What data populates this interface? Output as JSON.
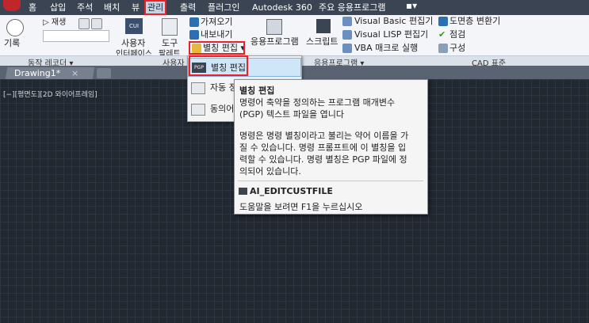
{
  "menubar": {
    "items": [
      "홈",
      "삽입",
      "주석",
      "배치",
      "뷰",
      "관리",
      "출력",
      "플러그인",
      "Autodesk 360",
      "주요 응용프로그램"
    ],
    "active": "관리"
  },
  "ribbon": {
    "action_recorder": {
      "record": "기록",
      "play": "재생"
    },
    "customization": {
      "user_interface": "사용자\n인터페이스",
      "tool_palette": "도구\n팔레트",
      "import": "가져오기",
      "export": "내보내기",
      "alias_edit": "별칭 편집"
    },
    "applications": {
      "app": "응용프로그램\n로드",
      "script": "스크립트\n실행",
      "vba": "VBA 매크로 실행",
      "vb_editor": "Visual Basic 편집기",
      "lisp_editor": "Visual LISP 편집기"
    },
    "cad_standards": {
      "layer_translator": "도면층 변환기",
      "check": "점검",
      "configure": "구성"
    },
    "panels": {
      "action_recorder": "동작 레코더 ▾",
      "customization": "사용자",
      "applications": "응용프로그램 ▾",
      "cad_standards": "CAD 표준"
    }
  },
  "file_tab": {
    "name": "Drawing1*",
    "close": "×"
  },
  "viewport": {
    "label": "[−][평면도][2D 와이어프레임]"
  },
  "dropdown": {
    "items": [
      "별칭 편집",
      "자동 정...",
      "동의어..."
    ]
  },
  "tooltip": {
    "title": "별칭 편집",
    "desc": [
      "명령어 축약을 정의하는 프로그램 매개변수",
      "(PGP) 텍스트 파일을 엽니다"
    ],
    "body": [
      "명령은 명령 별칭이라고 불리는 약어 이름을 가",
      "질 수 있습니다. 명령 프롬프트에 이 별칭을 입",
      "력할 수 있습니다. 명령 별칭은 PGP 파일에 정",
      "의되어 있습니다."
    ],
    "command": "AI_EDITCUSTFILE",
    "help": "도움말을 보려면 F1을 누르십시오"
  }
}
